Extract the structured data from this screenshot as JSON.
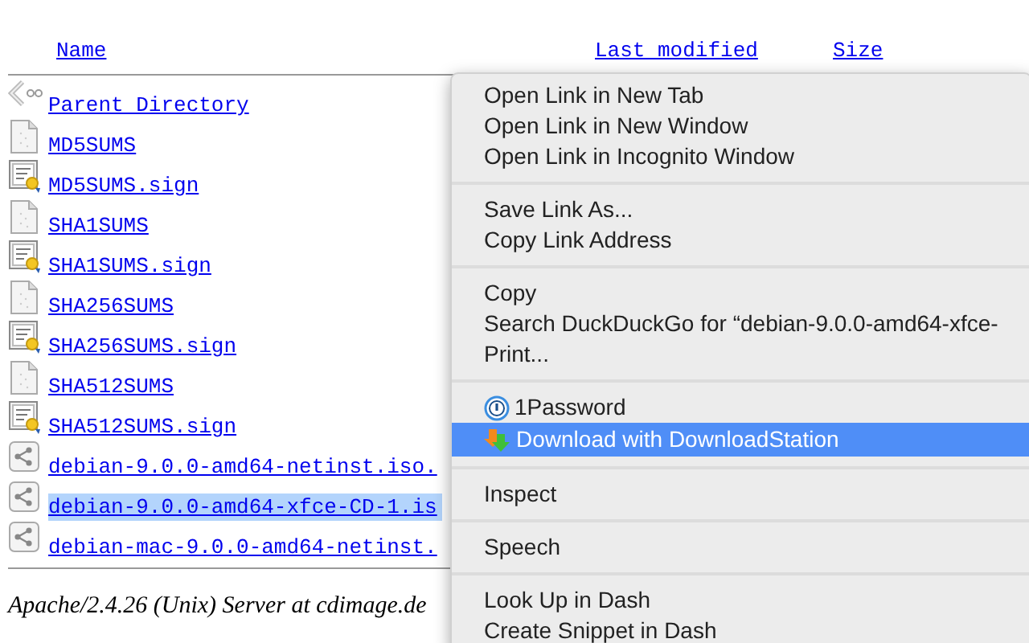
{
  "table": {
    "columns": [
      "Name",
      "Last modified",
      "Size"
    ],
    "rows": [
      {
        "kind": "parent",
        "name": "Parent Directory",
        "selected": false
      },
      {
        "kind": "text",
        "name": "MD5SUMS",
        "selected": false
      },
      {
        "kind": "signature",
        "name": "MD5SUMS.sign",
        "selected": false
      },
      {
        "kind": "text",
        "name": "SHA1SUMS",
        "selected": false
      },
      {
        "kind": "signature",
        "name": "SHA1SUMS.sign",
        "selected": false
      },
      {
        "kind": "text",
        "name": "SHA256SUMS",
        "selected": false
      },
      {
        "kind": "signature",
        "name": "SHA256SUMS.sign",
        "selected": false
      },
      {
        "kind": "text",
        "name": "SHA512SUMS",
        "selected": false
      },
      {
        "kind": "signature",
        "name": "SHA512SUMS.sign",
        "selected": false
      },
      {
        "kind": "binary",
        "name": "debian-9.0.0-amd64-netinst.iso.",
        "selected": false
      },
      {
        "kind": "binary",
        "name": "debian-9.0.0-amd64-xfce-CD-1.is",
        "selected": true
      },
      {
        "kind": "binary",
        "name": "debian-mac-9.0.0-amd64-netinst.",
        "selected": false
      }
    ]
  },
  "footer": "Apache/2.4.26 (Unix) Server at cdimage.de",
  "context_menu": {
    "sections": [
      {
        "items": [
          {
            "kind": "plain",
            "label": "Open Link in New Tab",
            "selected": false
          },
          {
            "kind": "plain",
            "label": "Open Link in New Window",
            "selected": false
          },
          {
            "kind": "plain",
            "label": "Open Link in Incognito Window",
            "selected": false
          }
        ]
      },
      {
        "items": [
          {
            "kind": "plain",
            "label": "Save Link As...",
            "selected": false
          },
          {
            "kind": "plain",
            "label": "Copy Link Address",
            "selected": false
          }
        ]
      },
      {
        "items": [
          {
            "kind": "plain",
            "label": "Copy",
            "selected": false
          },
          {
            "kind": "plain",
            "label": "Search DuckDuckGo for “debian-9.0.0-amd64-xfce-",
            "selected": false
          },
          {
            "kind": "plain",
            "label": "Print...",
            "selected": false
          }
        ]
      },
      {
        "items": [
          {
            "kind": "password",
            "label": "1Password",
            "selected": false
          },
          {
            "kind": "download",
            "label": "Download with DownloadStation",
            "selected": true
          }
        ]
      },
      {
        "items": [
          {
            "kind": "plain",
            "label": "Inspect",
            "selected": false
          }
        ]
      },
      {
        "items": [
          {
            "kind": "plain",
            "label": "Speech",
            "selected": false
          }
        ]
      },
      {
        "items": [
          {
            "kind": "plain",
            "label": "Look Up in Dash",
            "selected": false
          },
          {
            "kind": "plain",
            "label": "Create Snippet in Dash",
            "selected": false
          }
        ]
      }
    ]
  }
}
